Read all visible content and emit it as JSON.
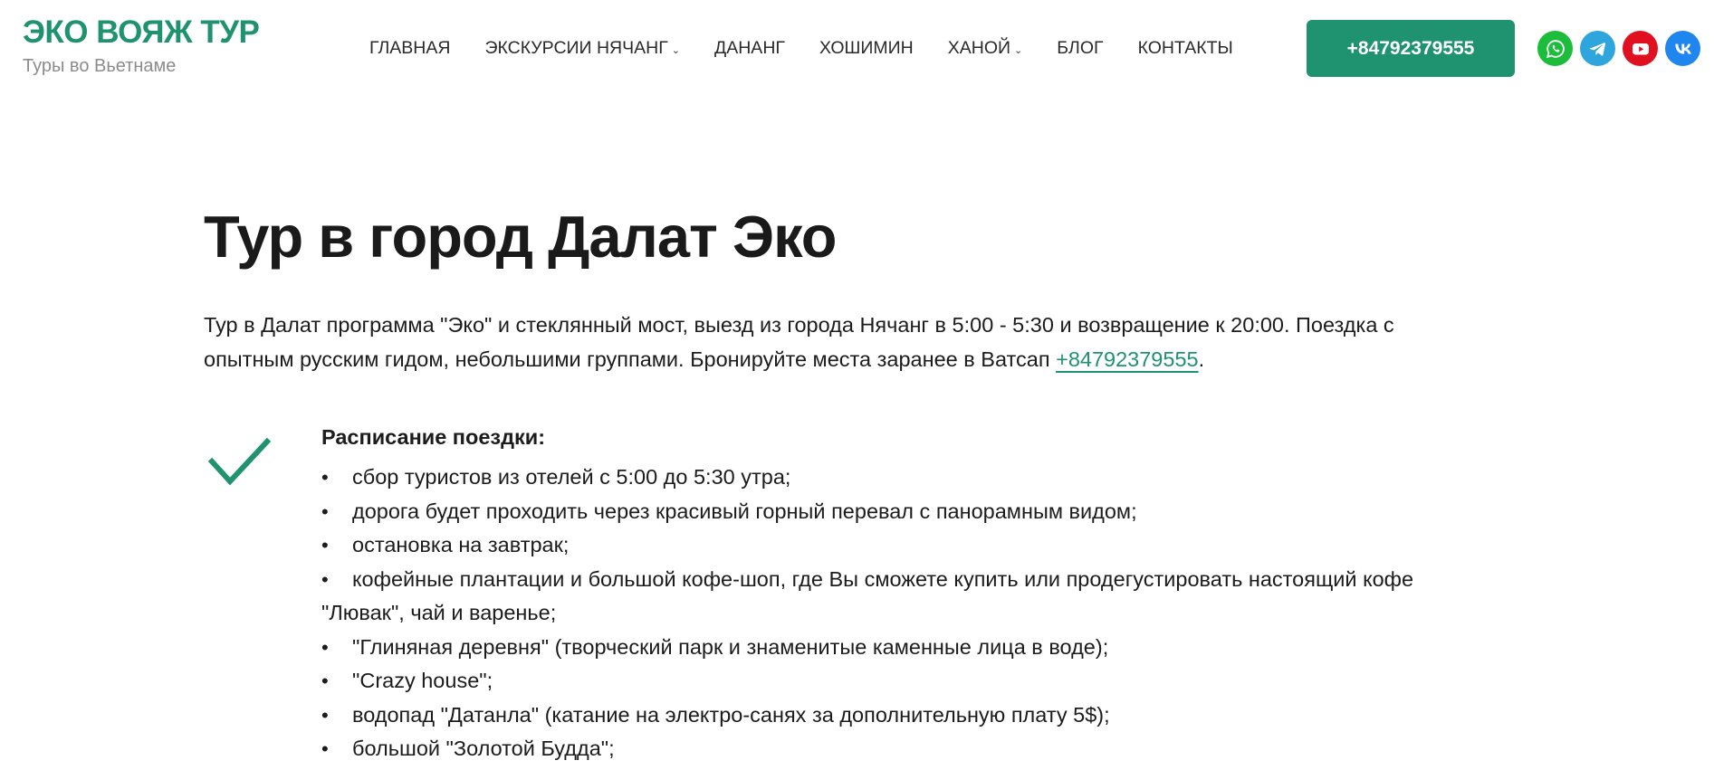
{
  "header": {
    "logo_title": "ЭКО ВОЯЖ ТУР",
    "logo_tagline": "Туры во Вьетнаме",
    "nav": [
      {
        "label": "ГЛАВНАЯ",
        "dropdown": false
      },
      {
        "label": "ЭКСКУРСИИ НЯЧАНГ",
        "dropdown": true
      },
      {
        "label": "ДАНАНГ",
        "dropdown": false
      },
      {
        "label": "ХОШИМИН",
        "dropdown": false
      },
      {
        "label": "ХАНОЙ",
        "dropdown": true
      },
      {
        "label": "БЛОГ",
        "dropdown": false
      },
      {
        "label": "КОНТАКТЫ",
        "dropdown": false
      }
    ],
    "phone_button": "+84792379555",
    "socials": [
      {
        "name": "whatsapp-icon",
        "color": "#1cbd3b"
      },
      {
        "name": "telegram-icon",
        "color": "#2fa5dd"
      },
      {
        "name": "youtube-icon",
        "color": "#e01020"
      },
      {
        "name": "vk-icon",
        "color": "#1f86f0"
      }
    ]
  },
  "main": {
    "title": "Тур в город Далат Эко",
    "intro_text": "Тур в Далат программа \"Эко\" и стеклянный мост, выезд из города Нячанг в 5:00 - 5:30 и возвращение к 20:00. Поездка с опытным русским гидом, небольшими группами. Бронируйте места заранее в Ватсап ",
    "intro_link": "+84792379555",
    "intro_end": ".",
    "schedule_heading": "Расписание поездки:",
    "schedule_items": [
      "сбор туристов из отелей с 5:00 до 5:30 утра;",
      "дорога будет проходить через красивый горный перевал с панорамным видом;",
      "остановка на завтрак;",
      "кофейные плантации и большой кофе-шоп, где Вы сможете купить или продегустировать настоящий кофе \"Лювак\", чай и варенье;",
      "\"Глиняная деревня\" (творческий парк и знаменитые каменные лица в воде);",
      "\"Crazy house\";",
      "водопад \"Датанла\" (катание на электро-санях за дополнительную плату 5$);",
      "большой \"Золотой Будда\";"
    ]
  },
  "colors": {
    "accent": "#1f9270",
    "text": "#1c1c1c",
    "tagline": "#8c8c8c"
  }
}
